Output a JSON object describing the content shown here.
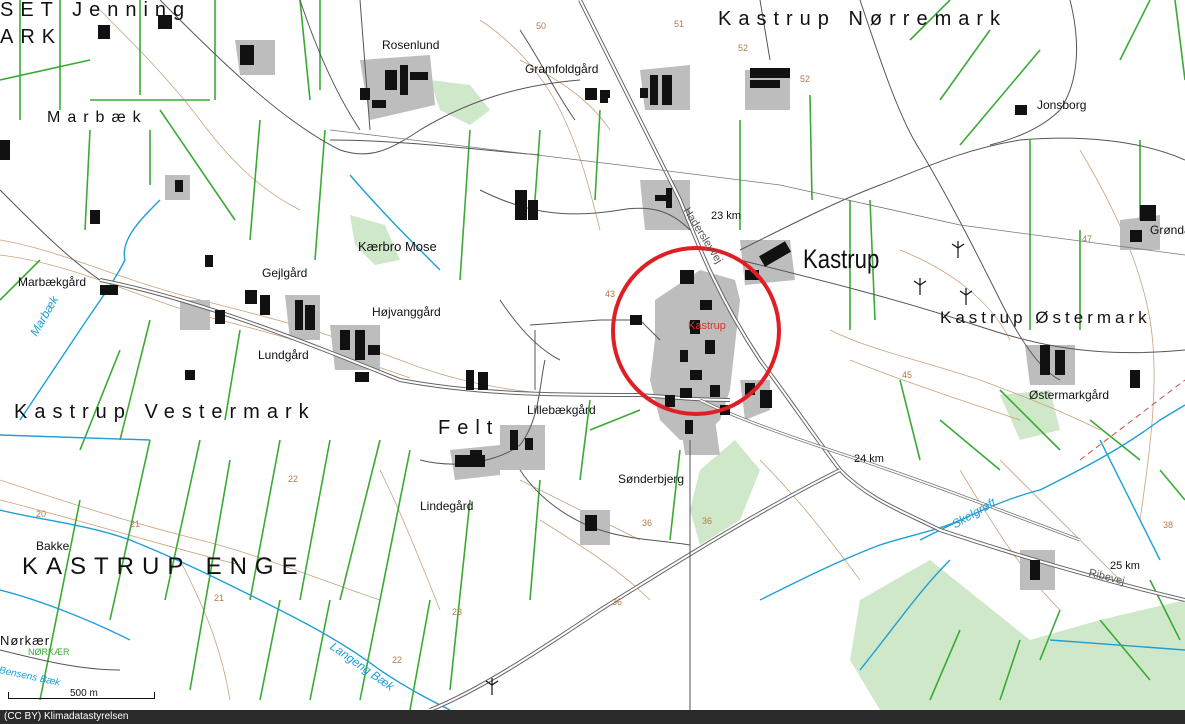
{
  "labels": {
    "set_jenning": "SET Jenning",
    "ark": "ARK",
    "kastrup_norremark": "Kastrup Nørremark",
    "rosenlund": "Rosenlund",
    "gramfoldgaard": "Gramfoldgård",
    "jonsborg": "Jonsborg",
    "marbaek": "Marbæk",
    "kaerbro_mose": "Kærbro Mose",
    "kastrup": "Kastrup",
    "marbaekgaard": "Marbækgård",
    "gejlgaard": "Gejlgård",
    "hojvanggaard": "Højvanggård",
    "lundgaard": "Lundgård",
    "kastrup_ostermark": "Kastrup Østermark",
    "grondal": "Grønda",
    "kastrup_small": "Kastrup",
    "ostermarkgaard": "Østermarkgård",
    "kastrup_vestermark": "Kastrup Vestermark",
    "felt": "Felt",
    "lillebaekgaard": "Lillebækgård",
    "sonderbjerg": "Sønderbjerg",
    "lindegaard": "Lindegård",
    "bakke": "Bakke",
    "kastrup_enge": "KASTRUP ENGE",
    "norkaer": "Nørkær",
    "norkaer_caps": "NØRKÆR"
  },
  "water": {
    "marbaek": "Marbæk",
    "skelgroft": "Skelgrøft",
    "langeng_baek": "Langeng Bæk",
    "bjensens": "Bensens Bæk"
  },
  "roads": {
    "haderslevvej": "Haderslevvej",
    "ribevej": "Ribevej"
  },
  "km_markers": {
    "km23": "23 km",
    "km24": "24 km",
    "km25": "25 km"
  },
  "contours": [
    "50",
    "51",
    "52",
    "52",
    "43",
    "47",
    "45",
    "20",
    "21",
    "22",
    "23",
    "21",
    "22",
    "36",
    "36",
    "38",
    "36"
  ],
  "scale_bar": {
    "label": "500 m"
  },
  "attribution": "(CC BY) Klimadatastyrelsen",
  "colors": {
    "field_lines": "#3aaa35",
    "water": "#1e9fd6",
    "buildings": "#111111",
    "settlement": "#bdbdbd",
    "contour": "#c9a27a",
    "forest": "#c8e6c2",
    "marker_circle": "#e01e26"
  }
}
